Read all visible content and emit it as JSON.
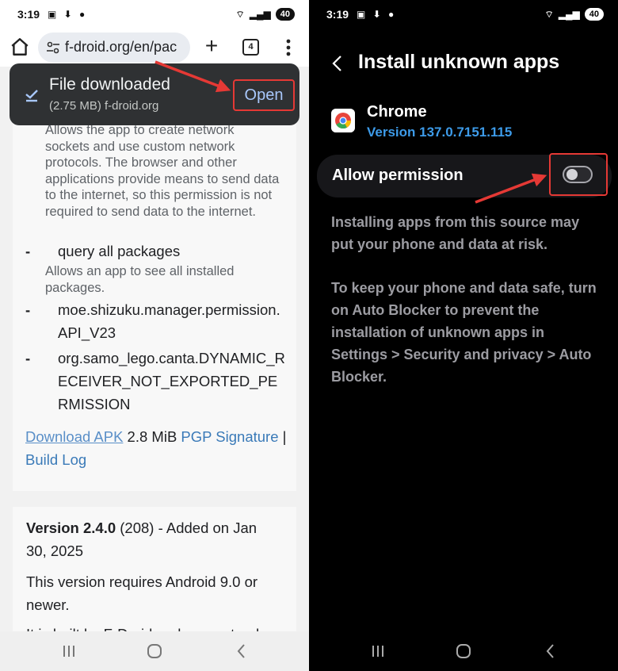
{
  "left": {
    "status": {
      "time": "3:19",
      "battery": "40"
    },
    "toolbar": {
      "url": "f-droid.org/en/pac",
      "tab_count": "4"
    },
    "snackbar": {
      "title": "File downloaded",
      "subtitle": "(2.75 MB) f-droid.org",
      "action": "Open"
    },
    "permission_intro": "Allows the app to create network sockets and use custom network protocols. The browser and other applications provide means to send data to the internet, so this permission is not required to send data to the internet.",
    "permissions": [
      {
        "dash": "-",
        "name": "query all packages",
        "description": "Allows an app to see all installed packages."
      },
      {
        "dash": "-",
        "name": "moe.shizuku.manager.permission.API_V23"
      },
      {
        "dash": "-",
        "name": "org.samo_lego.canta.DYNAMIC_RECEIVER_NOT_EXPORTED_PERMISSION"
      }
    ],
    "links": {
      "download_apk": "Download APK",
      "size": " 2.8 MiB ",
      "pgp": "PGP Signature",
      "separator": " | ",
      "build_log": "Build Log"
    },
    "version_block": {
      "version": "Version 2.4.0",
      "code": " (208)",
      "added": " - Added on Jan 30, 2025",
      "requires": "This version requires Android 9.0 or newer.",
      "cut_text": "It is built by F-Droid and guaranteed"
    }
  },
  "right": {
    "status": {
      "time": "3:19",
      "battery": "40"
    },
    "title": "Install unknown apps",
    "app": {
      "name": "Chrome",
      "version": "Version 137.0.7151.115"
    },
    "permission_label": "Allow permission",
    "toggle_state": "off",
    "warning_1": "Installing apps from this source may put your phone and data at risk.",
    "warning_2": "To keep your phone and data safe, turn on Auto Blocker to prevent the installation of unknown apps in Settings > Security and privacy > Auto Blocker."
  },
  "colors": {
    "annotation_red": "#e53935",
    "link_blue": "#3a7ab8",
    "version_blue": "#3d9be9"
  }
}
